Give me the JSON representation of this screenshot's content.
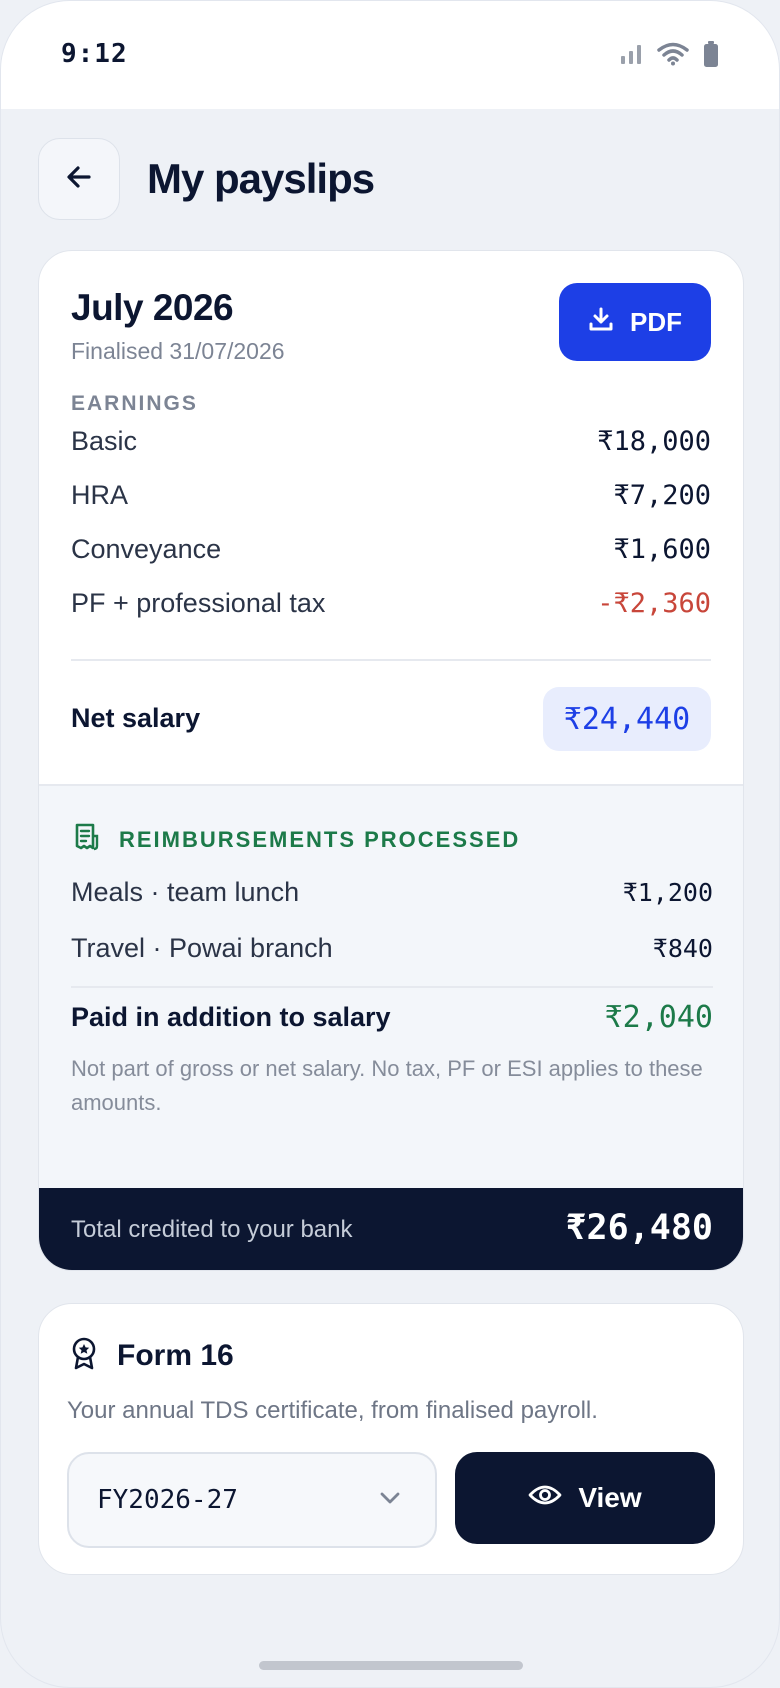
{
  "status_bar": {
    "time": "9:12"
  },
  "header": {
    "title": "My payslips"
  },
  "payslip": {
    "month": "July 2026",
    "finalised": "Finalised 31/07/2026",
    "pdf_label": "PDF",
    "earnings_label": "EARNINGS",
    "earnings": [
      {
        "label": "Basic",
        "amount": "₹18,000"
      },
      {
        "label": "HRA",
        "amount": "₹7,200"
      },
      {
        "label": "Conveyance",
        "amount": "₹1,600"
      },
      {
        "label": "PF + professional tax",
        "amount": "-₹2,360"
      }
    ],
    "net_label": "Net salary",
    "net_amount": "₹24,440",
    "reimbursements_title": "REIMBURSEMENTS PROCESSED",
    "reimbursements": [
      {
        "label": "Meals · team lunch",
        "amount": "₹1,200"
      },
      {
        "label": "Travel · Powai branch",
        "amount": "₹840"
      }
    ],
    "extra_label": "Paid in addition to salary",
    "extra_amount": "₹2,040",
    "note": "Not part of gross or net salary. No tax, PF or ESI applies to these amounts.",
    "total_label": "Total credited to your bank",
    "total_amount": "₹26,480"
  },
  "form16": {
    "title": "Form 16",
    "description": "Your annual TDS certificate, from finalised payroll.",
    "fy_selected": "FY2026-27",
    "view_label": "View"
  },
  "colors": {
    "primary": "#1d3fe6",
    "navy": "#0c1631",
    "green": "#1c7a49",
    "negative": "#c8463a"
  }
}
